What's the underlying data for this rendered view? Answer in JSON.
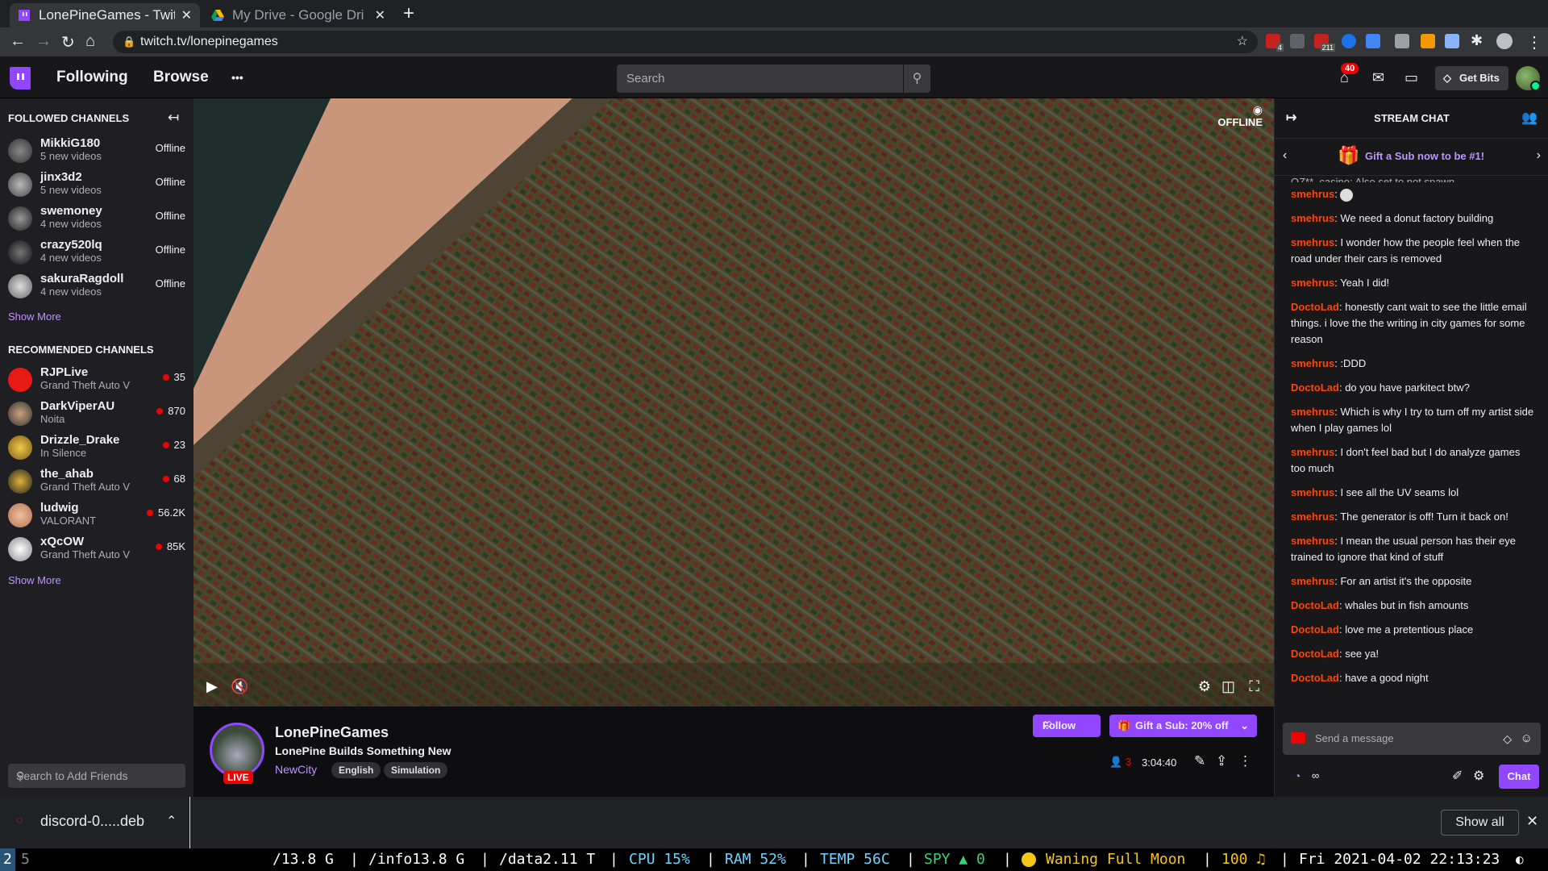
{
  "browser": {
    "tabs": [
      {
        "label": "LonePineGames - Twit",
        "active": true
      },
      {
        "label": "My Drive - Google Dri",
        "active": false
      }
    ],
    "url": "twitch.tv/lonepinegames",
    "ext_badges": {
      "e1": "4",
      "e2": "211"
    }
  },
  "topnav": {
    "following": "Following",
    "browse": "Browse",
    "more": "•••",
    "search_placeholder": "Search",
    "notif_count": "40",
    "get_bits": "Get Bits"
  },
  "sidebar": {
    "followed_header": "FOLLOWED CHANNELS",
    "followed": [
      {
        "name": "MikkiG180",
        "sub": "5 new videos",
        "status": "Offline"
      },
      {
        "name": "jinx3d2",
        "sub": "5 new videos",
        "status": "Offline"
      },
      {
        "name": "swemoney",
        "sub": "4 new videos",
        "status": "Offline"
      },
      {
        "name": "crazy520lq",
        "sub": "4 new videos",
        "status": "Offline"
      },
      {
        "name": "sakuraRagdoll",
        "sub": "4 new videos",
        "status": "Offline"
      }
    ],
    "show_more": "Show More",
    "recommended_header": "RECOMMENDED CHANNELS",
    "recommended": [
      {
        "name": "RJPLive",
        "sub": "Grand Theft Auto V",
        "viewers": "35"
      },
      {
        "name": "DarkViperAU",
        "sub": "Noita",
        "viewers": "870"
      },
      {
        "name": "Drizzle_Drake",
        "sub": "In Silence",
        "viewers": "23"
      },
      {
        "name": "the_ahab",
        "sub": "Grand Theft Auto V",
        "viewers": "68"
      },
      {
        "name": "ludwig",
        "sub": "VALORANT",
        "viewers": "56.2K"
      },
      {
        "name": "xQcOW",
        "sub": "Grand Theft Auto V",
        "viewers": "85K"
      }
    ],
    "friends_search": "Search to Add Friends"
  },
  "video": {
    "status": "OFFLINE"
  },
  "stream": {
    "channel": "LonePineGames",
    "title": "LonePine Builds Something New",
    "game": "NewCity",
    "tags": [
      "English",
      "Simulation"
    ],
    "live": "LIVE",
    "follow": "Follow",
    "gift": "Gift a Sub: 20% off",
    "viewers": "3",
    "uptime": "3:04:40"
  },
  "chat": {
    "header": "STREAM CHAT",
    "banner": "Gift a Sub now to be #1!",
    "partial": "OZ**_casino: Also set to not spawn.",
    "messages": [
      {
        "user": "smehrus",
        "text": ""
      },
      {
        "user": "smehrus",
        "text": "We need a donut factory building"
      },
      {
        "user": "smehrus",
        "text": "I wonder how the people feel when the road under their cars is removed"
      },
      {
        "user": "smehrus",
        "text": "Yeah I did!"
      },
      {
        "user": "DoctoLad",
        "text": "honestly cant wait to see the little email things. i love the the writing in city games for some reason"
      },
      {
        "user": "smehrus",
        "text": ":DDD"
      },
      {
        "user": "DoctoLad",
        "text": "do you have parkitect btw?"
      },
      {
        "user": "smehrus",
        "text": "Which is why I try to turn off my artist side when I play games lol"
      },
      {
        "user": "smehrus",
        "text": "I don't feel bad but I do analyze games too much"
      },
      {
        "user": "smehrus",
        "text": "I see all the UV seams lol"
      },
      {
        "user": "smehrus",
        "text": "The generator is off! Turn it back on!"
      },
      {
        "user": "smehrus",
        "text": "I mean the usual person has their eye trained to ignore that kind of stuff"
      },
      {
        "user": "smehrus",
        "text": "For an artist it's the opposite"
      },
      {
        "user": "DoctoLad",
        "text": "whales but in fish amounts"
      },
      {
        "user": "DoctoLad",
        "text": "love me a pretentious place"
      },
      {
        "user": "DoctoLad",
        "text": "see ya!"
      },
      {
        "user": "DoctoLad",
        "text": "have a good night"
      }
    ],
    "input_placeholder": "Send a message",
    "points": "∞",
    "chat_button": "Chat",
    "user_colors": {
      "smehrus": "#ff4500",
      "DoctoLad": "#ff4500"
    }
  },
  "downloads": {
    "file": "discord-0.....deb",
    "show_all": "Show all"
  },
  "statusbar": {
    "workspaces": [
      "2",
      "5"
    ],
    "items": [
      "/13.8 G",
      "|",
      "/info13.8 G",
      "|",
      "/data2.11 T",
      "|",
      "CPU 15%",
      "|",
      "RAM 52%",
      "|",
      "TEMP 56C",
      "|",
      "SPY ▲ 0",
      "|",
      "Waning Full Moon",
      "|",
      "100 ♫",
      "|",
      "Fri 2021-04-02 22:13:23"
    ]
  }
}
